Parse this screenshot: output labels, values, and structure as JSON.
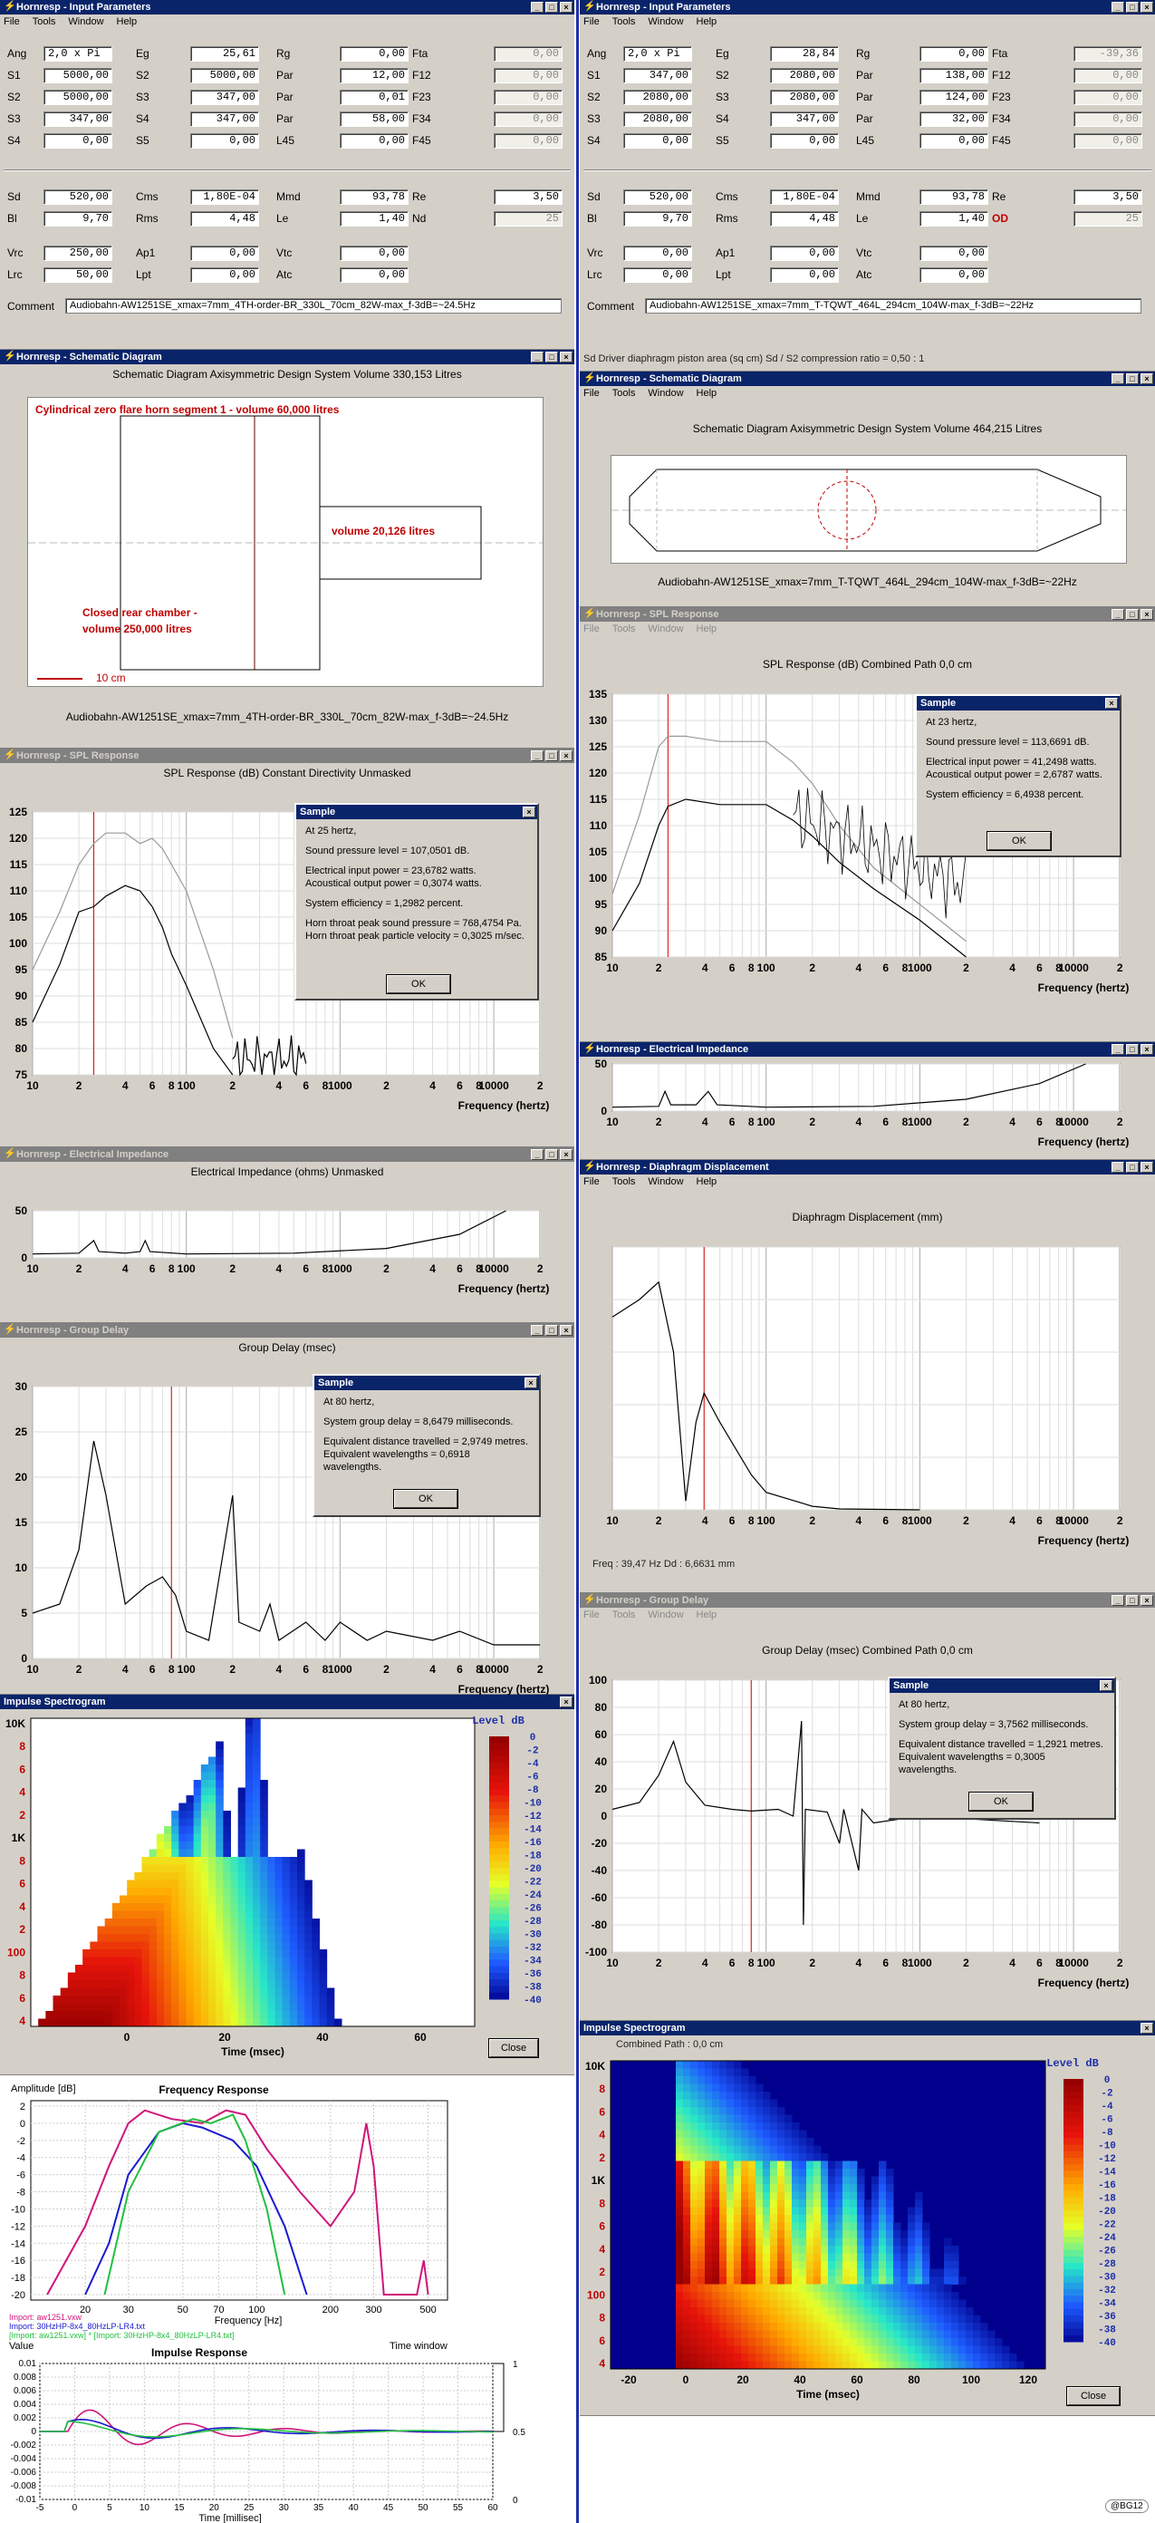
{
  "menu": {
    "file": "File",
    "tools": "Tools",
    "window": "Window",
    "help": "Help"
  },
  "left": {
    "input": {
      "title": "Hornresp - Input Parameters",
      "rows1": [
        [
          {
            "l": "Ang",
            "v": "2,0 x Pi",
            "angle": true
          },
          {
            "l": "Eg",
            "v": "25,61"
          },
          {
            "l": "Rg",
            "v": "0,00"
          },
          {
            "l": "Fta",
            "v": "0,00",
            "ro": true
          }
        ],
        [
          {
            "l": "S1",
            "v": "5000,00"
          },
          {
            "l": "S2",
            "v": "5000,00"
          },
          {
            "l": "Par",
            "v": "12,00"
          },
          {
            "l": "F12",
            "v": "0,00",
            "ro": true
          }
        ],
        [
          {
            "l": "S2",
            "v": "5000,00"
          },
          {
            "l": "S3",
            "v": "347,00"
          },
          {
            "l": "Par",
            "v": "0,01"
          },
          {
            "l": "F23",
            "v": "0,00",
            "ro": true
          }
        ],
        [
          {
            "l": "S3",
            "v": "347,00"
          },
          {
            "l": "S4",
            "v": "347,00"
          },
          {
            "l": "Par",
            "v": "58,00"
          },
          {
            "l": "F34",
            "v": "0,00",
            "ro": true
          }
        ],
        [
          {
            "l": "S4",
            "v": "0,00"
          },
          {
            "l": "S5",
            "v": "0,00"
          },
          {
            "l": "L45",
            "v": "0,00"
          },
          {
            "l": "F45",
            "v": "0,00",
            "ro": true
          }
        ]
      ],
      "rows2": [
        [
          {
            "l": "Sd",
            "v": "520,00"
          },
          {
            "l": "Cms",
            "v": "1,80E-04"
          },
          {
            "l": "Mmd",
            "v": "93,78"
          },
          {
            "l": "Re",
            "v": "3,50"
          }
        ],
        [
          {
            "l": "Bl",
            "v": "9,70"
          },
          {
            "l": "Rms",
            "v": "4,48"
          },
          {
            "l": "Le",
            "v": "1,40"
          },
          {
            "l": "Nd",
            "v": "25",
            "ro": true
          }
        ],
        [
          {
            "l": "Vrc",
            "v": "250,00"
          },
          {
            "l": "Ap1",
            "v": "0,00"
          },
          {
            "l": "Vtc",
            "v": "0,00"
          },
          null
        ],
        [
          {
            "l": "Lrc",
            "v": "50,00"
          },
          {
            "l": "Lpt",
            "v": "0,00"
          },
          {
            "l": "Atc",
            "v": "0,00"
          },
          null
        ]
      ],
      "comment_label": "Comment",
      "comment": "Audiobahn-AW1251SE_xmax=7mm_4TH-order-BR_330L_70cm_82W-max_f-3dB=~24.5Hz"
    },
    "schematic": {
      "title": "Hornresp - Schematic Diagram",
      "heading": "Schematic Diagram   Axisymmetric Design   System Volume 330,153 Litres",
      "label_horn": "Cylindrical zero flare horn segment 1 - volume 60,000 litres",
      "label_vol": "volume 20,126 litres",
      "label_rear1": "Closed rear chamber -",
      "label_rear2": "volume 250,000 litres",
      "scale": "10 cm",
      "caption": "Audiobahn-AW1251SE_xmax=7mm_4TH-order-BR_330L_70cm_82W-max_f-3dB=~24.5Hz"
    },
    "spl": {
      "title": "Hornresp - SPL Response",
      "heading": "SPL Response (dB)   Constant Directivity   Unmasked",
      "yticks": [
        "125",
        "120",
        "115",
        "110",
        "105",
        "100",
        "95",
        "90",
        "85",
        "80",
        "75"
      ],
      "xticks": [
        "10",
        "2",
        "4",
        "6",
        "8",
        "100",
        "2",
        "4",
        "6",
        "8",
        "1000",
        "2",
        "4",
        "6",
        "8",
        "10000",
        "2"
      ],
      "xlabel": "Frequency (hertz)",
      "dialog": {
        "title": "Sample",
        "l1": "At 25 hertz,",
        "l2": "Sound pressure level = 107,0501 dB.",
        "l3": "Electrical input power = 23,6782 watts.",
        "l4": "Acoustical output power = 0,3074 watts.",
        "l5": "System efficiency = 1,2982 percent.",
        "l6": "Horn throat peak sound pressure = 768,4754 Pa.",
        "l7": "Horn throat peak particle velocity = 0,3025 m/sec.",
        "ok": "OK"
      }
    },
    "imp": {
      "title": "Hornresp - Electrical Impedance",
      "heading": "Electrical Impedance (ohms)   Unmasked",
      "yticks": [
        "50",
        "0"
      ],
      "xticks": [
        "10",
        "2",
        "4",
        "6",
        "8",
        "100",
        "2",
        "4",
        "6",
        "8",
        "1000",
        "2",
        "4",
        "6",
        "8",
        "10000",
        "2"
      ],
      "xlabel": "Frequency (hertz)"
    },
    "gd": {
      "title": "Hornresp - Group Delay",
      "heading": "Group Delay (msec)",
      "yticks": [
        "30",
        "25",
        "20",
        "15",
        "10",
        "5",
        "0"
      ],
      "xticks": [
        "10",
        "2",
        "4",
        "6",
        "8",
        "100",
        "2",
        "4",
        "6",
        "8",
        "1000",
        "2",
        "4",
        "6",
        "8",
        "10000",
        "2"
      ],
      "xlabel": "Frequency (hertz)",
      "dialog": {
        "title": "Sample",
        "l1": "At 80 hertz,",
        "l2": "System group delay = 8,6479 milliseconds.",
        "l3": "Equivalent distance travelled = 2,9749 metres.",
        "l4": "Equivalent wavelengths = 0,6918 wavelengths.",
        "ok": "OK"
      }
    },
    "spectro": {
      "title": "Impulse Spectrogram",
      "yticks": [
        "10K",
        "8",
        "6",
        "4",
        "2",
        "1K",
        "8",
        "6",
        "4",
        "2",
        "100",
        "8",
        "6",
        "4"
      ],
      "xticks": [
        "0",
        "20",
        "40",
        "60"
      ],
      "xlabel": "Time (msec)",
      "legend_title": "Level   dB",
      "legend": [
        "0",
        "-2",
        "-4",
        "-6",
        "-8",
        "-10",
        "-12",
        "-14",
        "-16",
        "-18",
        "-20",
        "-22",
        "-24",
        "-26",
        "-28",
        "-30",
        "-32",
        "-34",
        "-36",
        "-38",
        "-40"
      ],
      "close": "Close"
    },
    "fr": {
      "amp_label": "Amplitude [dB]",
      "title": "Frequency Response",
      "yticks": [
        "2",
        "0",
        "-2",
        "-4",
        "-6",
        "-8",
        "-10",
        "-12",
        "-14",
        "-16",
        "-18",
        "-20"
      ],
      "xticks": [
        "20",
        "30",
        "50",
        "70",
        "100",
        "200",
        "300",
        "500"
      ],
      "xlabel": "Frequency [Hz]",
      "legend1": "Import: aw1251.vxw",
      "legend2": "Import: 30HzHP-8x4_80HzLP-LR4.txt",
      "legend3": "[Import: aw1251.vxw] * [Import: 30HzHP-8x4_80HzLP-LR4.txt]"
    },
    "ir": {
      "value_label": "Value",
      "title": "Impulse Response",
      "window_label": "Time window",
      "yticks": [
        "0.01",
        "0.008",
        "0.006",
        "0.004",
        "0.002",
        "0",
        "-0.002",
        "-0.004",
        "-0.006",
        "-0.008",
        "-0.01"
      ],
      "rticks": [
        "1",
        "0.5",
        "0"
      ],
      "xticks": [
        "-5",
        "0",
        "5",
        "10",
        "15",
        "20",
        "25",
        "30",
        "35",
        "40",
        "45",
        "50",
        "55",
        "60"
      ],
      "xlabel": "Time [millisec]"
    }
  },
  "right": {
    "input": {
      "title": "Hornresp - Input Parameters",
      "rows1": [
        [
          {
            "l": "Ang",
            "v": "2,0 x Pi",
            "angle": true
          },
          {
            "l": "Eg",
            "v": "28,84"
          },
          {
            "l": "Rg",
            "v": "0,00"
          },
          {
            "l": "Fta",
            "v": "-39,36",
            "ro": true
          }
        ],
        [
          {
            "l": "S1",
            "v": "347,00"
          },
          {
            "l": "S2",
            "v": "2080,00"
          },
          {
            "l": "Par",
            "v": "138,00"
          },
          {
            "l": "F12",
            "v": "0,00",
            "ro": true
          }
        ],
        [
          {
            "l": "S2",
            "v": "2080,00"
          },
          {
            "l": "S3",
            "v": "2080,00"
          },
          {
            "l": "Par",
            "v": "124,00"
          },
          {
            "l": "F23",
            "v": "0,00",
            "ro": true
          }
        ],
        [
          {
            "l": "S3",
            "v": "2080,00"
          },
          {
            "l": "S4",
            "v": "347,00"
          },
          {
            "l": "Par",
            "v": "32,00"
          },
          {
            "l": "F34",
            "v": "0,00",
            "ro": true
          }
        ],
        [
          {
            "l": "S4",
            "v": "0,00"
          },
          {
            "l": "S5",
            "v": "0,00"
          },
          {
            "l": "L45",
            "v": "0,00"
          },
          {
            "l": "F45",
            "v": "0,00",
            "ro": true
          }
        ]
      ],
      "rows2": [
        [
          {
            "l": "Sd",
            "v": "520,00"
          },
          {
            "l": "Cms",
            "v": "1,80E-04"
          },
          {
            "l": "Mmd",
            "v": "93,78"
          },
          {
            "l": "Re",
            "v": "3,50"
          }
        ],
        [
          {
            "l": "Bl",
            "v": "9,70"
          },
          {
            "l": "Rms",
            "v": "4,48"
          },
          {
            "l": "Le",
            "v": "1,40"
          },
          {
            "l": "OD",
            "v": "25",
            "ro": true,
            "red": true
          }
        ],
        [
          {
            "l": "Vrc",
            "v": "0,00"
          },
          {
            "l": "Ap1",
            "v": "0,00"
          },
          {
            "l": "Vtc",
            "v": "0,00"
          },
          null
        ],
        [
          {
            "l": "Lrc",
            "v": "0,00"
          },
          {
            "l": "Lpt",
            "v": "0,00"
          },
          {
            "l": "Atc",
            "v": "0,00"
          },
          null
        ]
      ],
      "comment_label": "Comment",
      "comment": "Audiobahn-AW1251SE_xmax=7mm_T-TQWT_464L_294cm_104W-max_f-3dB=~22Hz",
      "status": "Sd  Driver diaphragm piston area (sq cm)   Sd / S2 compression ratio = 0,50 : 1"
    },
    "schematic": {
      "title": "Hornresp - Schematic Diagram",
      "heading": "Schematic Diagram   Axisymmetric Design   System Volume 464,215 Litres",
      "caption": "Audiobahn-AW1251SE_xmax=7mm_T-TQWT_464L_294cm_104W-max_f-3dB=~22Hz"
    },
    "spl": {
      "title": "Hornresp - SPL Response",
      "heading": "SPL Response (dB)   Combined   Path 0,0 cm",
      "yticks": [
        "135",
        "130",
        "125",
        "120",
        "115",
        "110",
        "105",
        "100",
        "95",
        "90",
        "85"
      ],
      "xticks": [
        "10",
        "2",
        "4",
        "6",
        "8",
        "100",
        "2",
        "4",
        "6",
        "8",
        "1000",
        "2",
        "4",
        "6",
        "8",
        "10000",
        "2"
      ],
      "xlabel": "Frequency (hertz)",
      "dialog": {
        "title": "Sample",
        "l1": "At 23 hertz,",
        "l2": "Sound pressure level = 113,6691 dB.",
        "l3": "Electrical input power = 41,2498 watts.",
        "l4": "Acoustical output power = 2,6787 watts.",
        "l5": "System efficiency = 6,4938 percent.",
        "ok": "OK"
      }
    },
    "imp": {
      "title": "Hornresp - Electrical Impedance",
      "yticks": [
        "50",
        "0"
      ],
      "xticks": [
        "10",
        "2",
        "4",
        "6",
        "8",
        "100",
        "2",
        "4",
        "6",
        "8",
        "1000",
        "2",
        "4",
        "6",
        "8",
        "10000",
        "2"
      ],
      "xlabel": "Frequency (hertz)"
    },
    "disp": {
      "title": "Hornresp - Diaphragm Displacement",
      "heading": "Diaphragm Displacement (mm)",
      "xticks": [
        "10",
        "2",
        "4",
        "6",
        "8",
        "100",
        "2",
        "4",
        "6",
        "8",
        "1000",
        "2",
        "4",
        "6",
        "8",
        "10000",
        "2"
      ],
      "xlabel": "Frequency (hertz)",
      "status": "Freq : 39,47 Hz    Dd : 6,6631 mm"
    },
    "gd": {
      "title": "Hornresp - Group Delay",
      "heading": "Group Delay (msec)   Combined   Path 0,0 cm",
      "yticks": [
        "100",
        "80",
        "60",
        "40",
        "20",
        "0",
        "-20",
        "-40",
        "-60",
        "-80",
        "-100"
      ],
      "xticks": [
        "10",
        "2",
        "4",
        "6",
        "8",
        "100",
        "2",
        "4",
        "6",
        "8",
        "1000",
        "2",
        "4",
        "6",
        "8",
        "10000",
        "2"
      ],
      "xlabel": "Frequency (hertz)",
      "dialog": {
        "title": "Sample",
        "l1": "At 80 hertz,",
        "l2": "System group delay = 3,7562 milliseconds.",
        "l3": "Equivalent distance travelled = 1,2921 metres.",
        "l4": "Equivalent wavelengths = 0,3005 wavelengths.",
        "ok": "OK"
      }
    },
    "spectro": {
      "title": "Impulse Spectrogram",
      "subtitle": "Combined    Path : 0,0 cm",
      "yticks": [
        "10K",
        "8",
        "6",
        "4",
        "2",
        "1K",
        "8",
        "6",
        "4",
        "2",
        "100",
        "8",
        "6",
        "4"
      ],
      "xticks": [
        "-20",
        "0",
        "20",
        "40",
        "60",
        "80",
        "100",
        "120"
      ],
      "xlabel": "Time (msec)",
      "legend_title": "Level   dB",
      "legend": [
        "0",
        "-2",
        "-4",
        "-6",
        "-8",
        "-10",
        "-12",
        "-14",
        "-16",
        "-18",
        "-20",
        "-22",
        "-24",
        "-26",
        "-28",
        "-30",
        "-32",
        "-34",
        "-36",
        "-38",
        "-40"
      ],
      "close": "Close"
    }
  },
  "watermark": "@BG12",
  "chart_data": [
    {
      "type": "line",
      "title": "SPL Response (dB)",
      "xlabel": "Frequency (hertz)",
      "ylim": [
        75,
        125
      ],
      "xscale": "log",
      "x": [
        10,
        15,
        20,
        25,
        30,
        40,
        50,
        60,
        70,
        80,
        100,
        150,
        200
      ],
      "series": [
        {
          "values": [
            85,
            96,
            106,
            107,
            109,
            111,
            110,
            107,
            103,
            98,
            92,
            80,
            75
          ]
        },
        {
          "values": [
            95,
            106,
            115,
            119,
            121,
            121,
            119,
            120,
            118,
            115,
            110,
            95,
            82
          ]
        }
      ],
      "sample": {
        "freq_hz": 25,
        "spl_db": 107.0501
      }
    },
    {
      "type": "line",
      "title": "SPL Response (dB)",
      "xlabel": "Frequency (hertz)",
      "ylim": [
        85,
        135
      ],
      "xscale": "log",
      "x": [
        10,
        15,
        20,
        23,
        30,
        50,
        100,
        150,
        200,
        300,
        500,
        1000,
        2000
      ],
      "series": [
        {
          "values": [
            90,
            99,
            110,
            113.67,
            115,
            114,
            114,
            111,
            108,
            103,
            98,
            92,
            85
          ]
        },
        {
          "values": [
            97,
            112,
            125,
            127,
            127,
            126,
            126,
            122,
            118,
            110,
            102,
            95,
            88
          ]
        }
      ],
      "sample": {
        "freq_hz": 23,
        "spl_db": 113.6691
      }
    },
    {
      "type": "line",
      "title": "Group Delay (msec)",
      "xlabel": "Frequency (hertz)",
      "ylim": [
        0,
        30
      ],
      "xscale": "log",
      "x": [
        10,
        20,
        30,
        50,
        70,
        80,
        100,
        150,
        200,
        300,
        500,
        1000,
        2000
      ],
      "values": [
        5,
        10,
        25,
        8,
        9,
        8.65,
        3,
        2,
        18,
        5,
        3,
        2,
        1.5
      ],
      "sample": {
        "freq_hz": 80,
        "delay_ms": 8.6479
      }
    },
    {
      "type": "line",
      "title": "Group Delay (msec)",
      "xlabel": "Frequency (hertz)",
      "ylim": [
        -100,
        100
      ],
      "xscale": "log",
      "x": [
        10,
        20,
        25,
        30,
        50,
        80,
        100,
        150,
        200,
        300,
        500
      ],
      "values": [
        5,
        15,
        55,
        20,
        5,
        3.76,
        5,
        0,
        80,
        -60,
        -5
      ],
      "sample": {
        "freq_hz": 80,
        "delay_ms": 3.7562
      }
    },
    {
      "type": "line",
      "title": "Diaphragm Displacement (mm)",
      "xlabel": "Frequency (hertz)",
      "x": [
        10,
        15,
        20,
        25,
        30,
        35,
        39.47,
        50,
        80,
        100,
        200
      ],
      "values": [
        11,
        12,
        13,
        9,
        0.5,
        5,
        6.66,
        5,
        2,
        1,
        0.2
      ],
      "sample": {
        "freq_hz": 39.47,
        "disp_mm": 6.6631
      }
    }
  ]
}
